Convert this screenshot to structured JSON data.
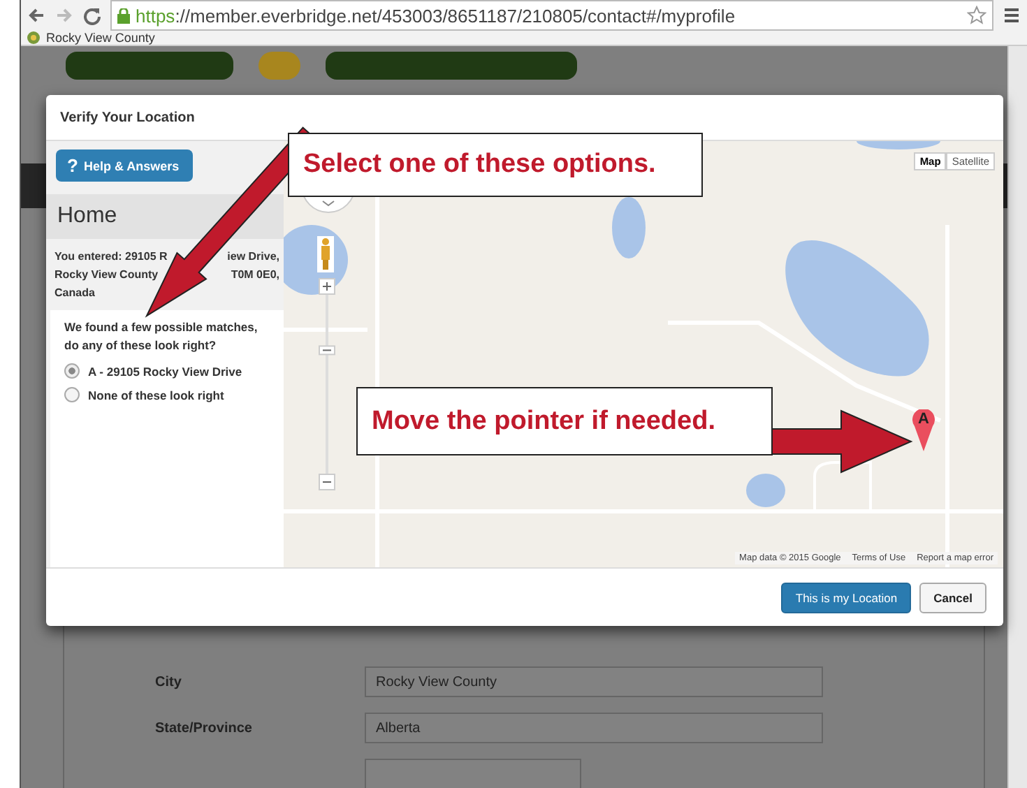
{
  "browser": {
    "url_scheme": "https",
    "url_rest": "://member.everbridge.net/453003/8651187/210805/contact#/myprofile",
    "bookmarks": [
      "Rocky View County"
    ]
  },
  "page": {
    "form": [
      {
        "label": "City",
        "value": "Rocky View County"
      },
      {
        "label": "State/Province",
        "value": "Alberta"
      }
    ]
  },
  "dialog": {
    "title": "Verify Your Location",
    "help_icon": "?",
    "help_button": "Help & Answers",
    "heading": "Home",
    "entered_lines": [
      [
        "You entered: 29105 R",
        "iew Drive,"
      ],
      [
        "Rocky View County",
        "T0M 0E0,"
      ],
      [
        "Canada"
      ]
    ],
    "question": "We found a few possible matches, do any of these look right?",
    "options": [
      {
        "label": "A - 29105 Rocky View Drive",
        "selected": true
      },
      {
        "label": "None of these look right",
        "selected": false
      }
    ],
    "map": {
      "types": [
        {
          "label": "Map",
          "selected": true
        },
        {
          "label": "Satellite",
          "selected": false
        }
      ],
      "marker": "A",
      "zoom": {
        "level": 0.69
      },
      "attribution": [
        "Map data © 2015 Google",
        "Terms of Use",
        "Report a map error"
      ]
    },
    "buttons": [
      {
        "label": "This is my Location",
        "kind": "primary"
      },
      {
        "label": "Cancel",
        "kind": "secondary"
      }
    ]
  },
  "callouts": [
    {
      "text": "Select one of these options."
    },
    {
      "text": "Move the pointer if needed."
    }
  ]
}
